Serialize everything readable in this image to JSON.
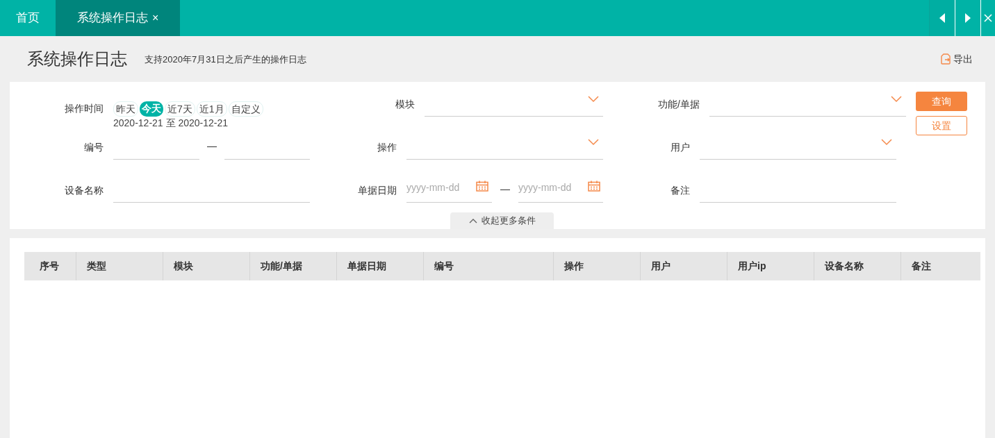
{
  "tabs": [
    {
      "label": "首页",
      "selected": false,
      "closable": false
    },
    {
      "label": "系统操作日志",
      "selected": true,
      "closable": true
    }
  ],
  "tab_close": "×",
  "header": {
    "title": "系统操作日志",
    "subtitle": "支持2020年7月31日之后产生的操作日志",
    "export": "导出"
  },
  "filters": {
    "time": {
      "label": "操作时间",
      "presets": [
        {
          "label": "昨天",
          "selected": false
        },
        {
          "label": "今天",
          "selected": true
        },
        {
          "label": "近7天",
          "selected": false
        },
        {
          "label": "近1月",
          "selected": false
        },
        {
          "label": "自定义",
          "selected": false
        }
      ],
      "range": "2020-12-21 至 2020-12-21"
    },
    "fields": [
      {
        "kind": "select",
        "label": "模块"
      },
      {
        "kind": "select",
        "label": "功能/单据"
      },
      {
        "kind": "range",
        "label": "编号",
        "separator": "—"
      },
      {
        "kind": "select",
        "label": "操作"
      },
      {
        "kind": "select",
        "label": "用户"
      },
      {
        "kind": "input",
        "label": "设备名称"
      },
      {
        "kind": "date_range",
        "label": "单据日期",
        "separator": "—",
        "placeholder_from": "yyyy-mm-dd",
        "placeholder_to": "yyyy-mm-dd"
      },
      {
        "kind": "input",
        "label": "备注"
      }
    ],
    "buttons": {
      "query": "查询",
      "settings": "设置"
    },
    "collapse": "收起更多条件"
  },
  "table": {
    "columns": [
      "序号",
      "类型",
      "模块",
      "功能/单据",
      "单据日期",
      "编号",
      "操作",
      "用户",
      "用户ip",
      "设备名称",
      "备注"
    ]
  }
}
